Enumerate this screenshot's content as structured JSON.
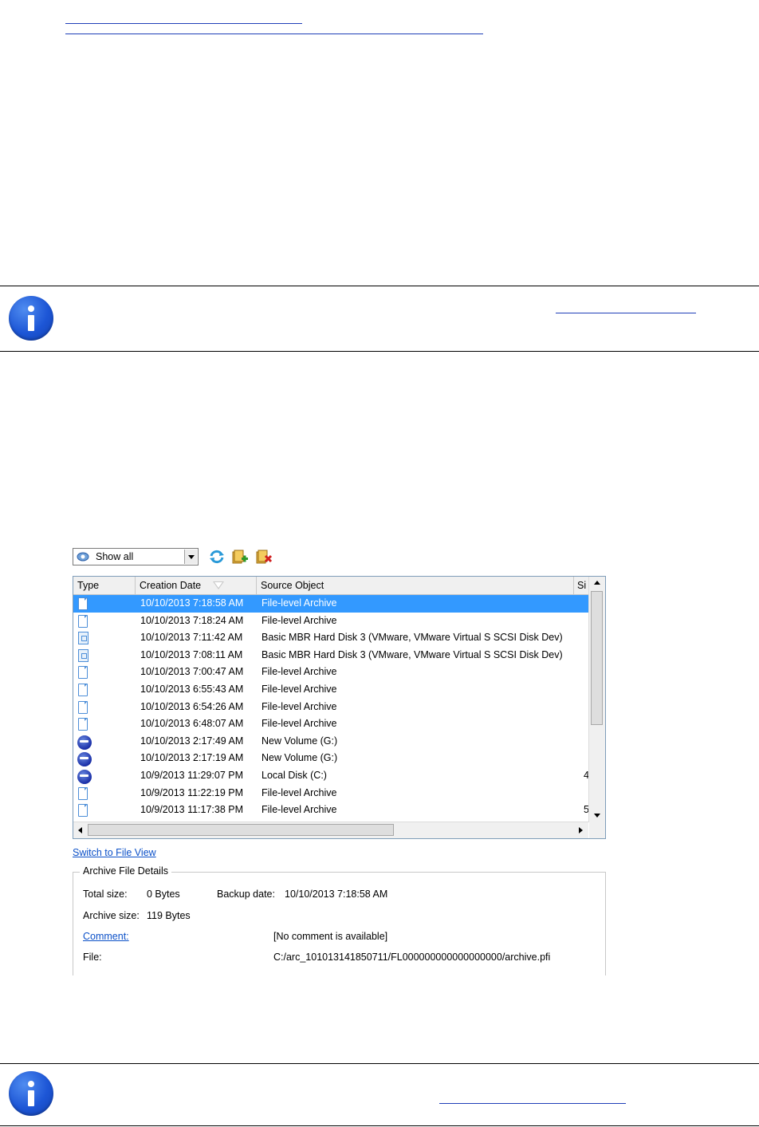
{
  "ui": {
    "filter_value": "Show all",
    "toolbar": {
      "refresh_icon": "refresh-icon",
      "add_icon": "add-archive-icon",
      "remove_icon": "remove-archive-icon"
    },
    "columns": [
      "Type",
      "Creation Date",
      "Source Object",
      "Si"
    ],
    "rows": [
      {
        "icon": "file-archive-icon",
        "date": "10/10/2013 7:18:58 AM",
        "source": "File-level Archive",
        "size": "",
        "selected": true
      },
      {
        "icon": "file-archive-icon",
        "date": "10/10/2013 7:18:24 AM",
        "source": "File-level Archive",
        "size": ""
      },
      {
        "icon": "disk-archive-icon",
        "date": "10/10/2013 7:11:42 AM",
        "source": "Basic MBR Hard Disk 3 (VMware, VMware Virtual S SCSI Disk Dev)",
        "size": ""
      },
      {
        "icon": "disk-archive-icon",
        "date": "10/10/2013 7:08:11 AM",
        "source": "Basic MBR Hard Disk 3 (VMware, VMware Virtual S SCSI Disk Dev)",
        "size": ""
      },
      {
        "icon": "file-archive-icon",
        "date": "10/10/2013 7:00:47 AM",
        "source": "File-level Archive",
        "size": ""
      },
      {
        "icon": "file-archive-icon",
        "date": "10/10/2013 6:55:43 AM",
        "source": "File-level Archive",
        "size": ""
      },
      {
        "icon": "file-archive-icon",
        "date": "10/10/2013 6:54:26 AM",
        "source": "File-level Archive",
        "size": ""
      },
      {
        "icon": "file-archive-icon",
        "date": "10/10/2013 6:48:07 AM",
        "source": "File-level Archive",
        "size": ""
      },
      {
        "icon": "volume-archive-icon",
        "date": "10/10/2013 2:17:49 AM",
        "source": "New Volume (G:)",
        "size": ""
      },
      {
        "icon": "volume-archive-icon",
        "date": "10/10/2013 2:17:19 AM",
        "source": "New Volume (G:)",
        "size": ""
      },
      {
        "icon": "volume-archive-icon",
        "date": "10/9/2013 11:29:07 PM",
        "source": "Local Disk (C:)",
        "size": "4"
      },
      {
        "icon": "file-archive-icon",
        "date": "10/9/2013 11:22:19 PM",
        "source": "File-level Archive",
        "size": ""
      },
      {
        "icon": "file-archive-icon",
        "date": "10/9/2013 11:17:38 PM",
        "source": "File-level Archive",
        "size": "5"
      }
    ],
    "switch_link": "Switch to File View",
    "details": {
      "legend": "Archive File Details",
      "total_size_label": "Total size:",
      "total_size_value": "0 Bytes",
      "backup_date_label": "Backup date:",
      "backup_date_value": "10/10/2013 7:18:58 AM",
      "archive_size_label": "Archive size:",
      "archive_size_value": "119 Bytes",
      "comment_label": "Comment:",
      "comment_value": "[No comment is available]",
      "file_label": "File:",
      "file_value": "C:/arc_101013141850711/FL000000000000000000/archive.pfi"
    }
  }
}
